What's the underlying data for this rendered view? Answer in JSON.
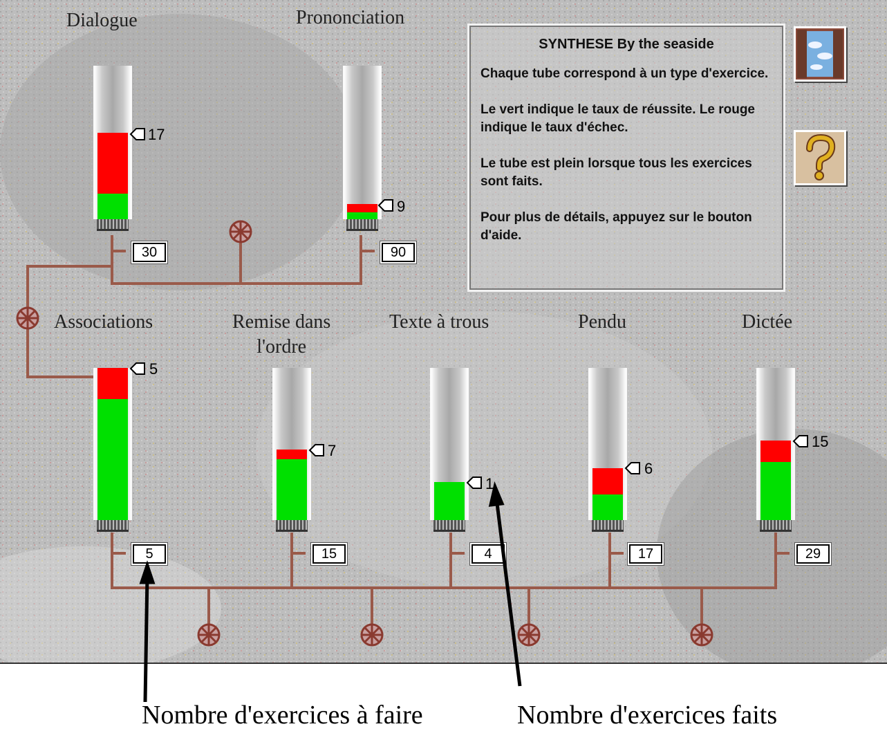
{
  "tubes": [
    {
      "title": "Dialogue",
      "done": "17",
      "todo": "30"
    },
    {
      "title": "Prononciation",
      "done": "9",
      "todo": "90"
    },
    {
      "title": "Associations",
      "done": "5",
      "todo": "5"
    },
    {
      "title": "Remise dans\nl'ordre",
      "done": "7",
      "todo": "15"
    },
    {
      "title": "Texte à trous",
      "done": "1",
      "todo": "4"
    },
    {
      "title": "Pendu",
      "done": "6",
      "todo": "17"
    },
    {
      "title": "Dictée",
      "done": "15",
      "todo": "29"
    }
  ],
  "info": {
    "title": "SYNTHESE By the seaside",
    "p1": "Chaque tube correspond à un type d'exercice.",
    "p2": "Le vert indique le taux de réussite. Le rouge indique le taux d'échec.",
    "p3": "Le tube est plein lorsque tous les exercices sont faits.",
    "p4": "Pour plus de détails, appuyez sur le bouton d'aide."
  },
  "buttons": {
    "window_icon": "window-scene-icon",
    "help_icon": "question-mark-icon"
  },
  "captions": {
    "left": "Nombre d'exercices à faire",
    "right": "Nombre d'exercices faits"
  },
  "colors": {
    "success": "#00e000",
    "failure": "#ff0000",
    "pipe": "#9a5a4a"
  }
}
